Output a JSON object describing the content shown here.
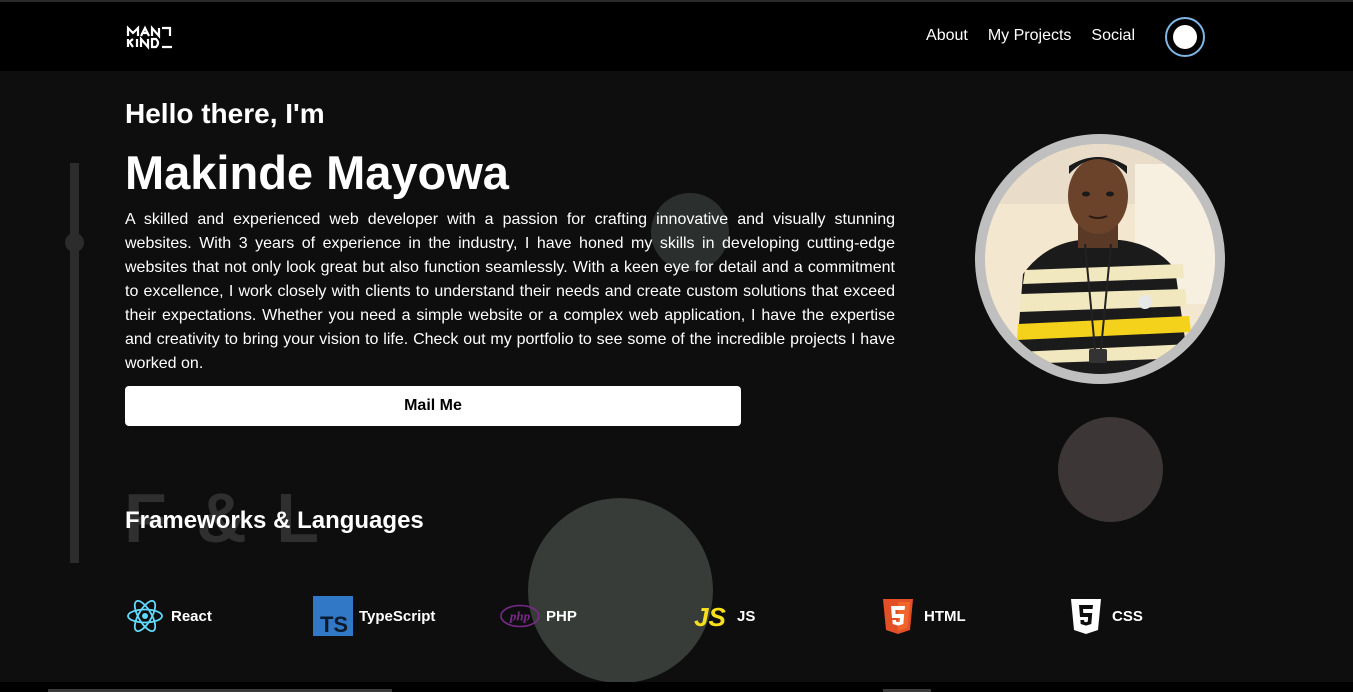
{
  "navbar": {
    "logo_text": "MAKINDE",
    "links": [
      "About",
      "My Projects",
      "Social"
    ]
  },
  "hero": {
    "greeting": "Hello there, I'm",
    "name": "Makinde Mayowa",
    "bio": "A skilled and experienced web developer with a passion for crafting innovative and visually stunning websites. With 3 years of experience in the industry, I have honed my skills in developing cutting-edge websites that not only look great but also function seamlessly. With a keen eye for detail and a commitment to excellence, I work closely with clients to understand their needs and create custom solutions that exceed their expectations. Whether you need a simple website or a complex web application, I have the expertise and creativity to bring your vision to life. Check out my portfolio to see some of the incredible projects I have worked on.",
    "mail_button": "Mail Me"
  },
  "skills_section": {
    "watermark": "F & L",
    "title": "Frameworks & Languages",
    "items": [
      {
        "label": "React",
        "icon": "react-icon",
        "color": "#61dafb"
      },
      {
        "label": "TypeScript",
        "icon": "typescript-icon",
        "color": "#3178c6"
      },
      {
        "label": "PHP",
        "icon": "php-icon",
        "color": "#7a2a8a"
      },
      {
        "label": "JS",
        "icon": "javascript-icon",
        "color": "#f7df1e"
      },
      {
        "label": "HTML",
        "icon": "html5-icon",
        "color": "#e34f26"
      },
      {
        "label": "CSS",
        "icon": "css3-icon",
        "color": "#ffffff"
      }
    ]
  },
  "colors": {
    "background": "#0e0e0f",
    "navbar": "#000000",
    "toggle_ring": "#7fb6e6",
    "button_bg": "#ffffff"
  }
}
